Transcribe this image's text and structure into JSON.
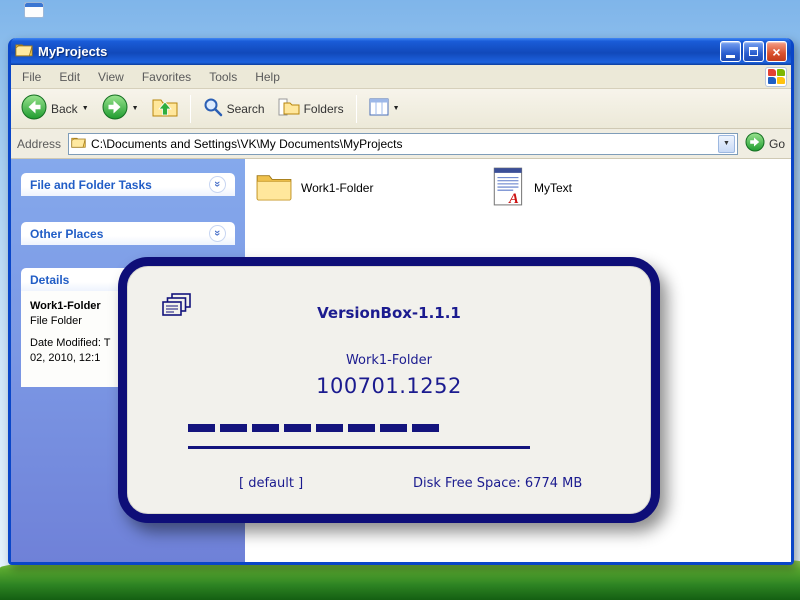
{
  "window": {
    "title": "MyProjects"
  },
  "icons": {
    "chevron": "»",
    "close": "×",
    "dropdown": "▼"
  },
  "menubar": {
    "items": [
      {
        "label": "File"
      },
      {
        "label": "Edit"
      },
      {
        "label": "View"
      },
      {
        "label": "Favorites"
      },
      {
        "label": "Tools"
      },
      {
        "label": "Help"
      }
    ]
  },
  "toolbar": {
    "back_label": "Back",
    "search_label": "Search",
    "folders_label": "Folders"
  },
  "addressbar": {
    "label": "Address",
    "path": "C:\\Documents and Settings\\VK\\My Documents\\MyProjects",
    "go_label": "Go"
  },
  "sidebar": {
    "sections": [
      {
        "title": "File and Folder Tasks"
      },
      {
        "title": "Other Places"
      },
      {
        "title": "Details"
      }
    ],
    "details": {
      "name": "Work1-Folder",
      "type": "File Folder",
      "date_line1": "Date Modified: T",
      "date_line2": "02, 2010, 12:1"
    }
  },
  "files": {
    "items": [
      {
        "name": "Work1-Folder"
      },
      {
        "name": "MyText"
      }
    ]
  },
  "dialog": {
    "title": "VersionBox-1.1.1",
    "item_name": "Work1-Folder",
    "version": "100701.1252",
    "progress_segments": 8,
    "default_label": "[ default ]",
    "disk_free_label": "Disk Free Space: 6774 MB"
  },
  "colors": {
    "titlebar_blue": "#1149ba",
    "dialog_navy": "#0e0e78",
    "sidebar_blue": "#7b97e4",
    "accent_green": "#2fae3f",
    "grass_green": "#2e8423"
  }
}
